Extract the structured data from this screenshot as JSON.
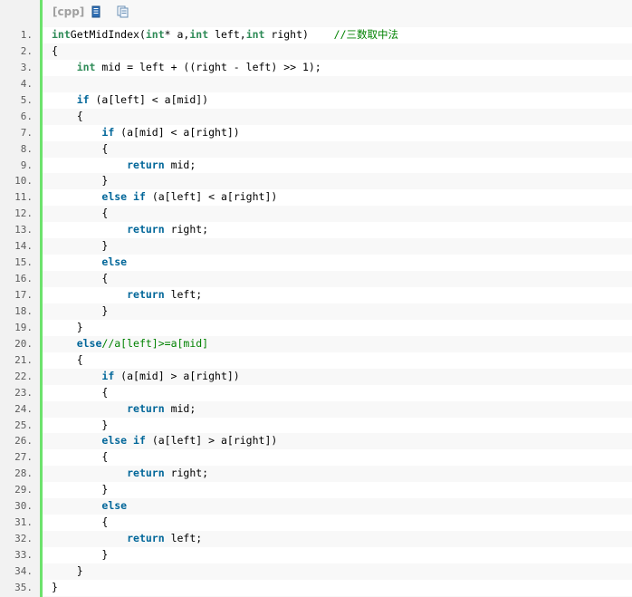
{
  "toolbar": {
    "language_label": "[cpp]",
    "icons": [
      "view-source-icon",
      "copy-icon"
    ]
  },
  "code": {
    "lines": [
      {
        "n": "1.",
        "indent": 0,
        "tokens": [
          [
            "ty",
            "int"
          ],
          [
            "",
            "GetMidIndex("
          ],
          [
            "ty",
            "int"
          ],
          [
            "",
            "* a,"
          ],
          [
            "ty",
            "int"
          ],
          [
            "",
            " left,"
          ],
          [
            "ty",
            "int"
          ],
          [
            "",
            " right)    "
          ],
          [
            "cm",
            "//三数取中法"
          ]
        ]
      },
      {
        "n": "2.",
        "indent": 0,
        "tokens": [
          [
            "",
            "{"
          ]
        ]
      },
      {
        "n": "3.",
        "indent": 1,
        "tokens": [
          [
            "ty",
            "int"
          ],
          [
            "",
            " mid = left + ((right - left) >> 1);"
          ]
        ]
      },
      {
        "n": "4.",
        "indent": 0,
        "tokens": []
      },
      {
        "n": "5.",
        "indent": 1,
        "tokens": [
          [
            "kw",
            "if"
          ],
          [
            "",
            " (a[left] < a[mid])"
          ]
        ]
      },
      {
        "n": "6.",
        "indent": 1,
        "tokens": [
          [
            "",
            "{"
          ]
        ]
      },
      {
        "n": "7.",
        "indent": 2,
        "tokens": [
          [
            "kw",
            "if"
          ],
          [
            "",
            " (a[mid] < a[right])"
          ]
        ]
      },
      {
        "n": "8.",
        "indent": 2,
        "tokens": [
          [
            "",
            "{"
          ]
        ]
      },
      {
        "n": "9.",
        "indent": 3,
        "tokens": [
          [
            "kw",
            "return"
          ],
          [
            "",
            " mid;"
          ]
        ]
      },
      {
        "n": "10.",
        "indent": 2,
        "tokens": [
          [
            "",
            "}"
          ]
        ]
      },
      {
        "n": "11.",
        "indent": 2,
        "tokens": [
          [
            "kw",
            "else"
          ],
          [
            "",
            " "
          ],
          [
            "kw",
            "if"
          ],
          [
            "",
            " (a[left] < a[right])"
          ]
        ]
      },
      {
        "n": "12.",
        "indent": 2,
        "tokens": [
          [
            "",
            "{"
          ]
        ]
      },
      {
        "n": "13.",
        "indent": 3,
        "tokens": [
          [
            "kw",
            "return"
          ],
          [
            "",
            " right;"
          ]
        ]
      },
      {
        "n": "14.",
        "indent": 2,
        "tokens": [
          [
            "",
            "}"
          ]
        ]
      },
      {
        "n": "15.",
        "indent": 2,
        "tokens": [
          [
            "kw",
            "else"
          ]
        ]
      },
      {
        "n": "16.",
        "indent": 2,
        "tokens": [
          [
            "",
            "{"
          ]
        ]
      },
      {
        "n": "17.",
        "indent": 3,
        "tokens": [
          [
            "kw",
            "return"
          ],
          [
            "",
            " left;"
          ]
        ]
      },
      {
        "n": "18.",
        "indent": 2,
        "tokens": [
          [
            "",
            "}"
          ]
        ]
      },
      {
        "n": "19.",
        "indent": 1,
        "tokens": [
          [
            "",
            "}"
          ]
        ]
      },
      {
        "n": "20.",
        "indent": 1,
        "tokens": [
          [
            "kw",
            "else"
          ],
          [
            "cm",
            "//a[left]>=a[mid]"
          ]
        ]
      },
      {
        "n": "21.",
        "indent": 1,
        "tokens": [
          [
            "",
            "{"
          ]
        ]
      },
      {
        "n": "22.",
        "indent": 2,
        "tokens": [
          [
            "kw",
            "if"
          ],
          [
            "",
            " (a[mid] > a[right])"
          ]
        ]
      },
      {
        "n": "23.",
        "indent": 2,
        "tokens": [
          [
            "",
            "{"
          ]
        ]
      },
      {
        "n": "24.",
        "indent": 3,
        "tokens": [
          [
            "kw",
            "return"
          ],
          [
            "",
            " mid;"
          ]
        ]
      },
      {
        "n": "25.",
        "indent": 2,
        "tokens": [
          [
            "",
            "}"
          ]
        ]
      },
      {
        "n": "26.",
        "indent": 2,
        "tokens": [
          [
            "kw",
            "else"
          ],
          [
            "",
            " "
          ],
          [
            "kw",
            "if"
          ],
          [
            "",
            " (a[left] > a[right])"
          ]
        ]
      },
      {
        "n": "27.",
        "indent": 2,
        "tokens": [
          [
            "",
            "{"
          ]
        ]
      },
      {
        "n": "28.",
        "indent": 3,
        "tokens": [
          [
            "kw",
            "return"
          ],
          [
            "",
            " right;"
          ]
        ]
      },
      {
        "n": "29.",
        "indent": 2,
        "tokens": [
          [
            "",
            "}"
          ]
        ]
      },
      {
        "n": "30.",
        "indent": 2,
        "tokens": [
          [
            "kw",
            "else"
          ]
        ]
      },
      {
        "n": "31.",
        "indent": 2,
        "tokens": [
          [
            "",
            "{"
          ]
        ]
      },
      {
        "n": "32.",
        "indent": 3,
        "tokens": [
          [
            "kw",
            "return"
          ],
          [
            "",
            " left;"
          ]
        ]
      },
      {
        "n": "33.",
        "indent": 2,
        "tokens": [
          [
            "",
            "}"
          ]
        ]
      },
      {
        "n": "34.",
        "indent": 1,
        "tokens": [
          [
            "",
            "}"
          ]
        ]
      },
      {
        "n": "35.",
        "indent": 0,
        "tokens": [
          [
            "",
            "}"
          ]
        ]
      }
    ]
  }
}
